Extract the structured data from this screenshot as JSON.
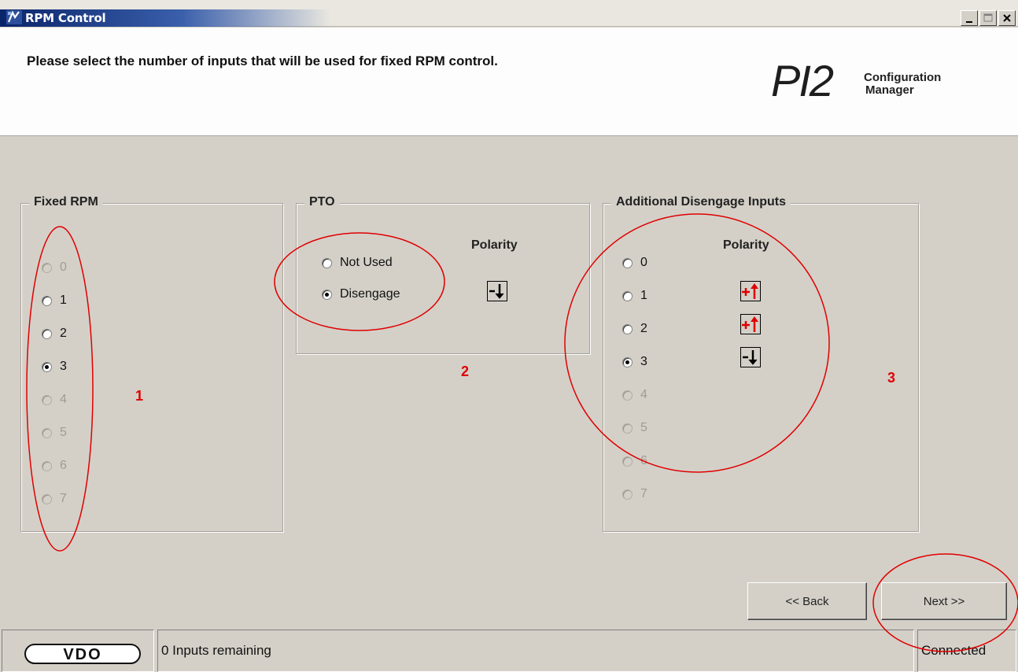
{
  "window": {
    "title": "RPM Control",
    "minimize_label": "_",
    "maximize_label": "□",
    "close_label": "X"
  },
  "header": {
    "instruction": "Please select the number of inputs that will be used for fixed RPM control.",
    "brand_main": "PI2",
    "brand_line1": "Configuration",
    "brand_line2": "Manager"
  },
  "fixed_rpm": {
    "title": "Fixed RPM",
    "options": [
      {
        "label": "0",
        "checked": false,
        "enabled": false
      },
      {
        "label": "1",
        "checked": false,
        "enabled": true
      },
      {
        "label": "2",
        "checked": false,
        "enabled": true
      },
      {
        "label": "3",
        "checked": true,
        "enabled": true
      },
      {
        "label": "4",
        "checked": false,
        "enabled": false
      },
      {
        "label": "5",
        "checked": false,
        "enabled": false
      },
      {
        "label": "6",
        "checked": false,
        "enabled": false
      },
      {
        "label": "7",
        "checked": false,
        "enabled": false
      }
    ]
  },
  "pto": {
    "title": "PTO",
    "polarity_label": "Polarity",
    "options": [
      {
        "label": "Not Used",
        "checked": false
      },
      {
        "label": "Disengage",
        "checked": true
      }
    ],
    "polarity": [
      "negative-down-icon"
    ]
  },
  "additional": {
    "title": "Additional Disengage Inputs",
    "polarity_label": "Polarity",
    "options": [
      {
        "label": "0",
        "checked": false,
        "enabled": true
      },
      {
        "label": "1",
        "checked": false,
        "enabled": true
      },
      {
        "label": "2",
        "checked": false,
        "enabled": true
      },
      {
        "label": "3",
        "checked": true,
        "enabled": true
      },
      {
        "label": "4",
        "checked": false,
        "enabled": false
      },
      {
        "label": "5",
        "checked": false,
        "enabled": false
      },
      {
        "label": "6",
        "checked": false,
        "enabled": false
      },
      {
        "label": "7",
        "checked": false,
        "enabled": false
      }
    ],
    "polarity": [
      "positive-up-icon",
      "positive-up-icon",
      "negative-down-icon"
    ]
  },
  "annotations": {
    "marker1": "1",
    "marker2": "2",
    "marker3": "3",
    "color": "#e00000"
  },
  "buttons": {
    "back": "<< Back",
    "next": "Next >>"
  },
  "statusbar": {
    "logo_text": "VDO",
    "message": "0 Inputs remaining",
    "connection": "Connected"
  }
}
